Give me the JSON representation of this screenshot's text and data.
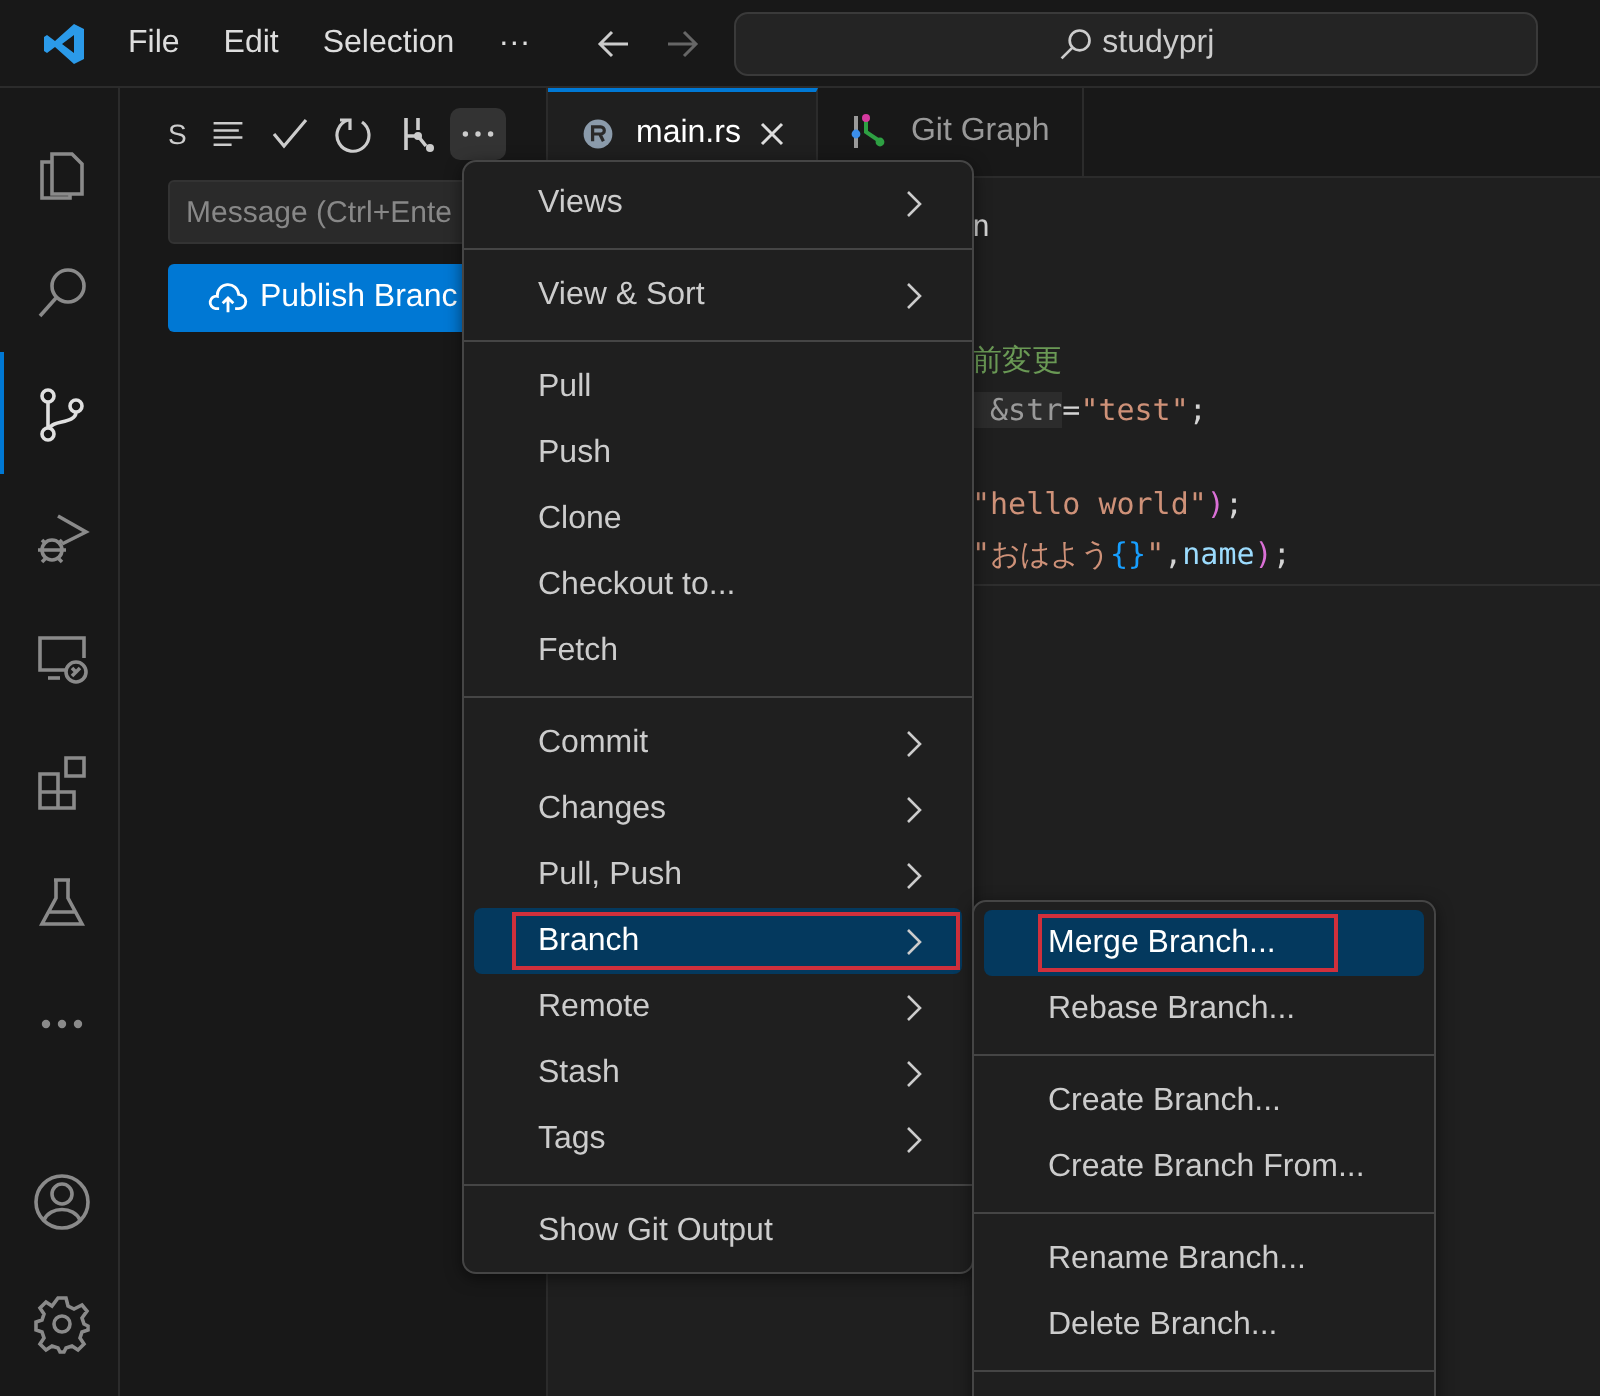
{
  "title_bar": {
    "menus": [
      "File",
      "Edit",
      "Selection",
      "···"
    ],
    "search": {
      "value": "studyprj"
    }
  },
  "activity_bar": {
    "items": [
      {
        "selected": false
      },
      {
        "selected": false
      },
      {
        "selected": true
      },
      {
        "selected": false
      },
      {
        "selected": false
      },
      {
        "selected": false
      },
      {
        "selected": false
      },
      {
        "selected": false
      }
    ]
  },
  "sidebar": {
    "title": "S",
    "message": {
      "placeholder": "Message (Ctrl+Ente"
    },
    "publish_button": "Publish Branc"
  },
  "tabs": [
    {
      "label": "main.rs",
      "selected": true
    },
    {
      "label": "Git Graph",
      "selected": false
    }
  ],
  "editor": {
    "lines": [
      {
        "segments": [
          {
            "text": "n",
            "kind": "plain"
          }
        ]
      },
      {
        "segments": [
          {
            "text": "前変更",
            "kind": "comment"
          }
        ]
      },
      {
        "segments": [
          {
            "text": " &str",
            "kind": "hint"
          },
          {
            "text": "=",
            "kind": "plain"
          },
          {
            "text": "\"test\"",
            "kind": "string"
          },
          {
            "text": ";",
            "kind": "plain"
          }
        ]
      },
      {
        "segments": [
          {
            "text": "\"hello world\"",
            "kind": "string"
          },
          {
            "text": ")",
            "kind": "paren"
          },
          {
            "text": ";",
            "kind": "plain"
          }
        ]
      },
      {
        "segments": [
          {
            "text": "\"おはよう",
            "kind": "string"
          },
          {
            "text": "{}",
            "kind": "brace"
          },
          {
            "text": "\"",
            "kind": "string"
          },
          {
            "text": ",",
            "kind": "plain"
          },
          {
            "text": "name",
            "kind": "variable"
          },
          {
            "text": ")",
            "kind": "paren"
          },
          {
            "text": ";",
            "kind": "plain"
          }
        ]
      }
    ]
  },
  "menu": {
    "groups": [
      [
        {
          "label": "Views",
          "submenu": true,
          "selected": false,
          "highlighted": false
        }
      ],
      [
        {
          "label": "View & Sort",
          "submenu": true,
          "selected": false,
          "highlighted": false
        }
      ],
      [
        {
          "label": "Pull",
          "submenu": false,
          "selected": false,
          "highlighted": false
        },
        {
          "label": "Push",
          "submenu": false,
          "selected": false,
          "highlighted": false
        },
        {
          "label": "Clone",
          "submenu": false,
          "selected": false,
          "highlighted": false
        },
        {
          "label": "Checkout to...",
          "submenu": false,
          "selected": false,
          "highlighted": false
        },
        {
          "label": "Fetch",
          "submenu": false,
          "selected": false,
          "highlighted": false
        }
      ],
      [
        {
          "label": "Commit",
          "submenu": true,
          "selected": false,
          "highlighted": false
        },
        {
          "label": "Changes",
          "submenu": true,
          "selected": false,
          "highlighted": false
        },
        {
          "label": "Pull, Push",
          "submenu": true,
          "selected": false,
          "highlighted": false
        },
        {
          "label": "Branch",
          "submenu": true,
          "selected": true,
          "highlighted": true
        },
        {
          "label": "Remote",
          "submenu": true,
          "selected": false,
          "highlighted": false
        },
        {
          "label": "Stash",
          "submenu": true,
          "selected": false,
          "highlighted": false
        },
        {
          "label": "Tags",
          "submenu": true,
          "selected": false,
          "highlighted": false
        }
      ],
      [
        {
          "label": "Show Git Output",
          "submenu": false,
          "selected": false,
          "highlighted": false
        }
      ]
    ]
  },
  "submenu": {
    "groups": [
      [
        {
          "label": "Merge Branch...",
          "selected": true,
          "highlighted": true
        },
        {
          "label": "Rebase Branch...",
          "selected": false,
          "highlighted": false
        }
      ],
      [
        {
          "label": "Create Branch...",
          "selected": false,
          "highlighted": false
        },
        {
          "label": "Create Branch From...",
          "selected": false,
          "highlighted": false
        }
      ],
      [
        {
          "label": "Rename Branch...",
          "selected": false,
          "highlighted": false
        },
        {
          "label": "Delete Branch...",
          "selected": false,
          "highlighted": false
        }
      ]
    ]
  }
}
